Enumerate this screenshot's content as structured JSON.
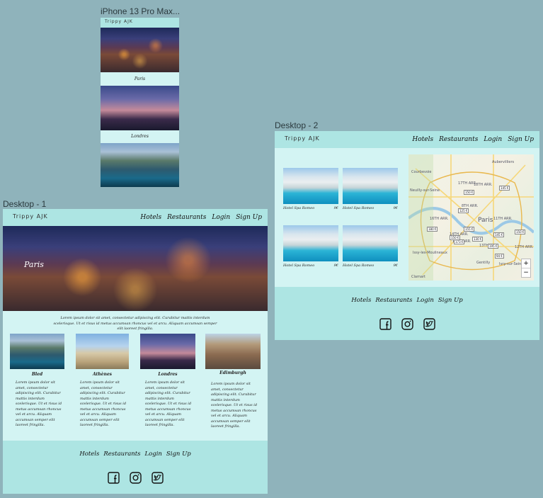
{
  "frames": {
    "mobile_label": "iPhone 13 Pro Max...",
    "desktop1_label": "Desktop - 1",
    "desktop2_label": "Desktop - 2"
  },
  "brand": "Trippy AJK",
  "nav": [
    "Hotels",
    "Restaurants",
    "Login",
    "Sign Up"
  ],
  "mobile": {
    "captions": [
      "Paris",
      "Londres"
    ]
  },
  "desktop1": {
    "hero_title": "Paris",
    "intro": "Lorem ipsum dolor sit amet, consectetur adipiscing elit. Curabitur mattis interdum scelerisque. Ut et risus id metus accumsan rhoncus vel et arcu. Aliquam accumsan semper elit laoreet fringilla.",
    "cards": [
      {
        "title": "Bled",
        "text": "Lorem ipsum dolor sit amet, consectetur adipiscing elit. Curabitur mattis interdum scelerisque. Ut et risus id metus accumsan rhoncus vel et arcu. Aliquam accumsan semper elit laoreet fringilla."
      },
      {
        "title": "Athènes",
        "text": "Lorem ipsum dolor sit amet, consectetur adipiscing elit. Curabitur mattis interdum scelerisque. Ut et risus id metus accumsan rhoncus vel et arcu. Aliquam accumsan semper elit laoreet fringilla."
      },
      {
        "title": "Londres",
        "text": "Lorem ipsum dolor sit amet, consectetur adipiscing elit. Curabitur mattis interdum scelerisque. Ut et risus id metus accumsan rhoncus vel et arcu. Aliquam accumsan semper elit laoreet fringilla."
      },
      {
        "title": "Edimburgh",
        "text": "Lorem ipsum dolor sit amet, consectetur adipiscing elit. Curabitur mattis interdum scelerisque. Ut et risus id metus accumsan rhoncus vel et arcu. Aliquam accumsan semper elit laoreet fringilla."
      }
    ]
  },
  "desktop2": {
    "hotels": [
      {
        "name": "Hotel Spa Romeo",
        "price": "9€"
      },
      {
        "name": "Hotel Spa Romeo",
        "price": "9€"
      },
      {
        "name": "Hotel Spa Romeo",
        "price": "9€"
      },
      {
        "name": "Hotel Spa Romeo",
        "price": "9€"
      }
    ],
    "map_labels": [
      "Paris",
      "17TH ARR.",
      "18TH ARR.",
      "16TH ARR.",
      "8TH ARR.",
      "15TH ARR.",
      "13TH ARR.",
      "11TH ARR.",
      "14TH ARR.",
      "12TH ARR.",
      "Courbevoie",
      "Neuilly-sur-Seine",
      "Aubervilliers",
      "Issy-les-Moulineaux",
      "Clamart",
      "Gentilly",
      "Ivry-sur-Seine"
    ],
    "map_prices": [
      "150 €",
      "145 €",
      "180 €",
      "125 €",
      "155 €",
      "150 €",
      "130 €",
      "145 €",
      "173 €",
      "150 €",
      "195 €",
      "94 €"
    ],
    "zoom_in": "+",
    "zoom_out": "−"
  },
  "colors": {
    "panel": "#ade5e3",
    "content": "#d3f4f3",
    "canvas": "#8fb3bb"
  }
}
